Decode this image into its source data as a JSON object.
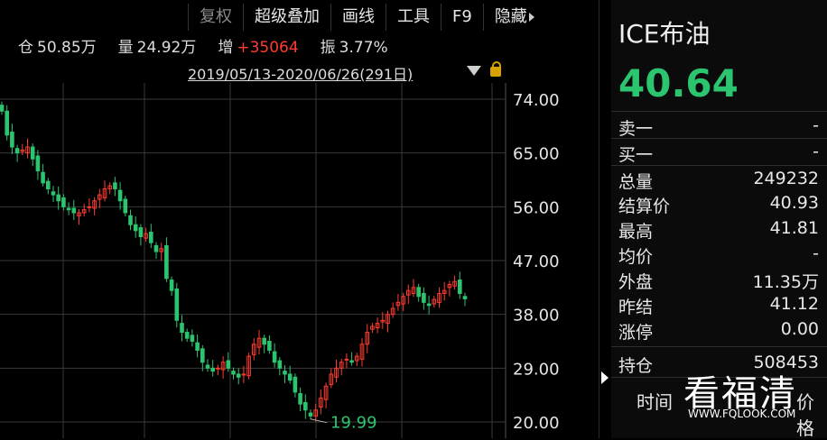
{
  "toolbar": {
    "items": [
      "复权",
      "超级叠加",
      "画线",
      "工具",
      "F9",
      "隐藏"
    ]
  },
  "stats": {
    "open_interest_label": "仓",
    "open_interest": "50.85万",
    "volume_label": "量",
    "volume": "24.92万",
    "increase_label": "增",
    "increase": "+35064",
    "amplitude_label": "振",
    "amplitude": "3.77%"
  },
  "range_text": "2019/05/13-2020/06/26(291日)",
  "colors": {
    "up": "#ff3b30",
    "down": "#2cc56f",
    "grid": "#3a3a3a",
    "background": "#000000"
  },
  "sidebar": {
    "title": "ICE布油",
    "price": "40.64",
    "sell": {
      "label": "卖一",
      "value": "-"
    },
    "buy": {
      "label": "买一",
      "value": "-"
    },
    "rows": [
      {
        "label": "总量",
        "value": "249232",
        "color": "normal"
      },
      {
        "label": "结算价",
        "value": "40.93",
        "color": "normal"
      },
      {
        "label": "最高",
        "value": "41.81",
        "color": "red"
      },
      {
        "label": "均价",
        "value": "-",
        "color": "normal"
      },
      {
        "label": "外盘",
        "value": "11.35万",
        "color": "red"
      },
      {
        "label": "昨结",
        "value": "41.12",
        "color": "normal"
      },
      {
        "label": "涨停",
        "value": "0.00",
        "color": "red"
      }
    ],
    "open_interest": {
      "label": "持仓",
      "value": "508453"
    },
    "time_label": "时间",
    "price_label": "价格"
  },
  "watermark": {
    "text": "看福清",
    "url": "WWW.FQLOOK.COM"
  },
  "chart_data": {
    "type": "candlestick",
    "y_ticks": [
      "74.00",
      "65.00",
      "56.00",
      "47.00",
      "38.00",
      "29.00",
      "20.00"
    ],
    "ylim": [
      20,
      74
    ],
    "min_label": "19.99",
    "closes": [
      72,
      68,
      66,
      65,
      65.5,
      66,
      64,
      62,
      60,
      59,
      58,
      57,
      56,
      55.5,
      55,
      55,
      55.5,
      56,
      57,
      58,
      59,
      59.5,
      59,
      57,
      55,
      53,
      52,
      51,
      51.5,
      50,
      48.5,
      49,
      44,
      42,
      37,
      35,
      34,
      33.5,
      32,
      30,
      29,
      28.5,
      29,
      30,
      29,
      28,
      27.5,
      28,
      31,
      33,
      34,
      33,
      32,
      30,
      29,
      28,
      27,
      25,
      23,
      22,
      21,
      22,
      24,
      26,
      28,
      29,
      30,
      30.5,
      30,
      31,
      33,
      35,
      36,
      36.5,
      37,
      38,
      39,
      40,
      41,
      42,
      42.5,
      41,
      40,
      39.5,
      40.5,
      41.5,
      42,
      43,
      43.5,
      41.5,
      40.6
    ]
  }
}
